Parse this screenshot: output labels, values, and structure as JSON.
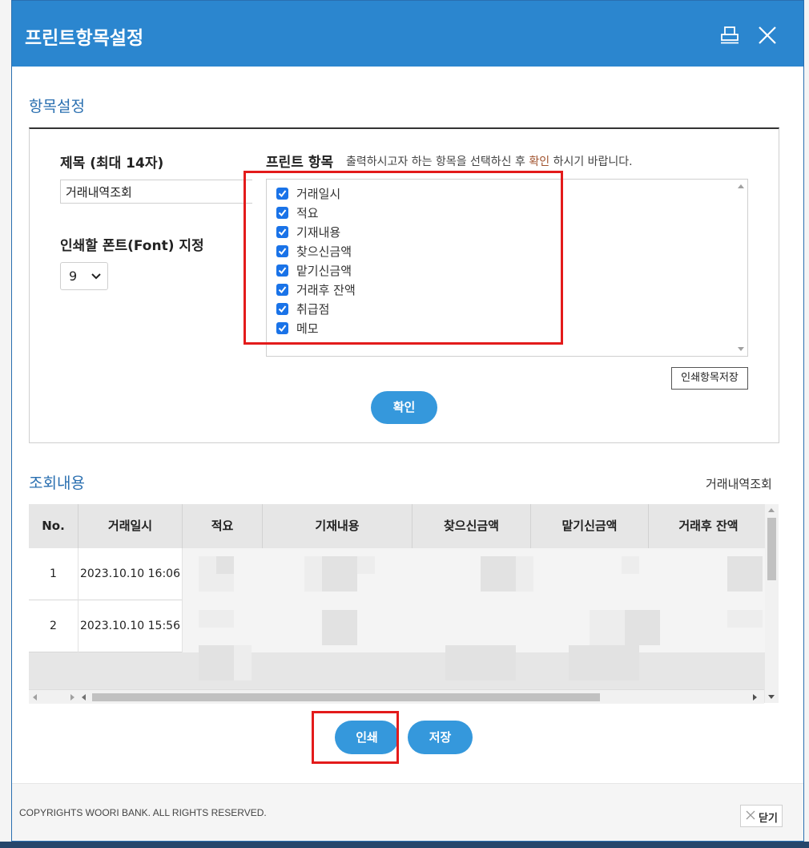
{
  "window": {
    "title": "프린트항목설정",
    "print_icon": "printer-icon",
    "close_icon": "close-icon"
  },
  "settings": {
    "section_title": "항목설정",
    "title_label": "제목 (최대 14자)",
    "title_value": "거래내역조회",
    "font_label": "인쇄할 폰트(Font) 지정",
    "font_value": "9",
    "print_items_label": "프린트 항목",
    "print_items_desc_before": "출력하시고자 하는 항목을 선택하신 후",
    "print_items_desc_highlight": "확인",
    "print_items_desc_after": "하시기 바랍니다.",
    "items": [
      {
        "label": "거래일시",
        "checked": true
      },
      {
        "label": "적요",
        "checked": true
      },
      {
        "label": "기재내용",
        "checked": true
      },
      {
        "label": "찾으신금액",
        "checked": true
      },
      {
        "label": "맡기신금액",
        "checked": true
      },
      {
        "label": "거래후 잔액",
        "checked": true
      },
      {
        "label": "취급점",
        "checked": true
      },
      {
        "label": "메모",
        "checked": true
      }
    ],
    "save_items_button": "인쇄항목저장",
    "confirm_button": "확인"
  },
  "results": {
    "section_title": "조회내용",
    "right_label": "거래내역조회",
    "columns": [
      "No.",
      "거래일시",
      "적요",
      "기재내용",
      "찾으신금액",
      "맡기신금액",
      "거래후 잔액"
    ],
    "rows": [
      {
        "no": "1",
        "datetime": "2023.10.10 16:06"
      },
      {
        "no": "2",
        "datetime": "2023.10.10 15:56"
      }
    ]
  },
  "actions": {
    "print_button": "인쇄",
    "save_button": "저장"
  },
  "footer": {
    "copyright": "COPYRIGHTS WOORI BANK. ALL RIGHTS RESERVED.",
    "close_button": "닫기"
  },
  "colors": {
    "titlebar": "#2b86cf",
    "accent_button": "#3598dc",
    "section_title": "#2a6fb0",
    "annotation_red": "#e31b1b"
  }
}
